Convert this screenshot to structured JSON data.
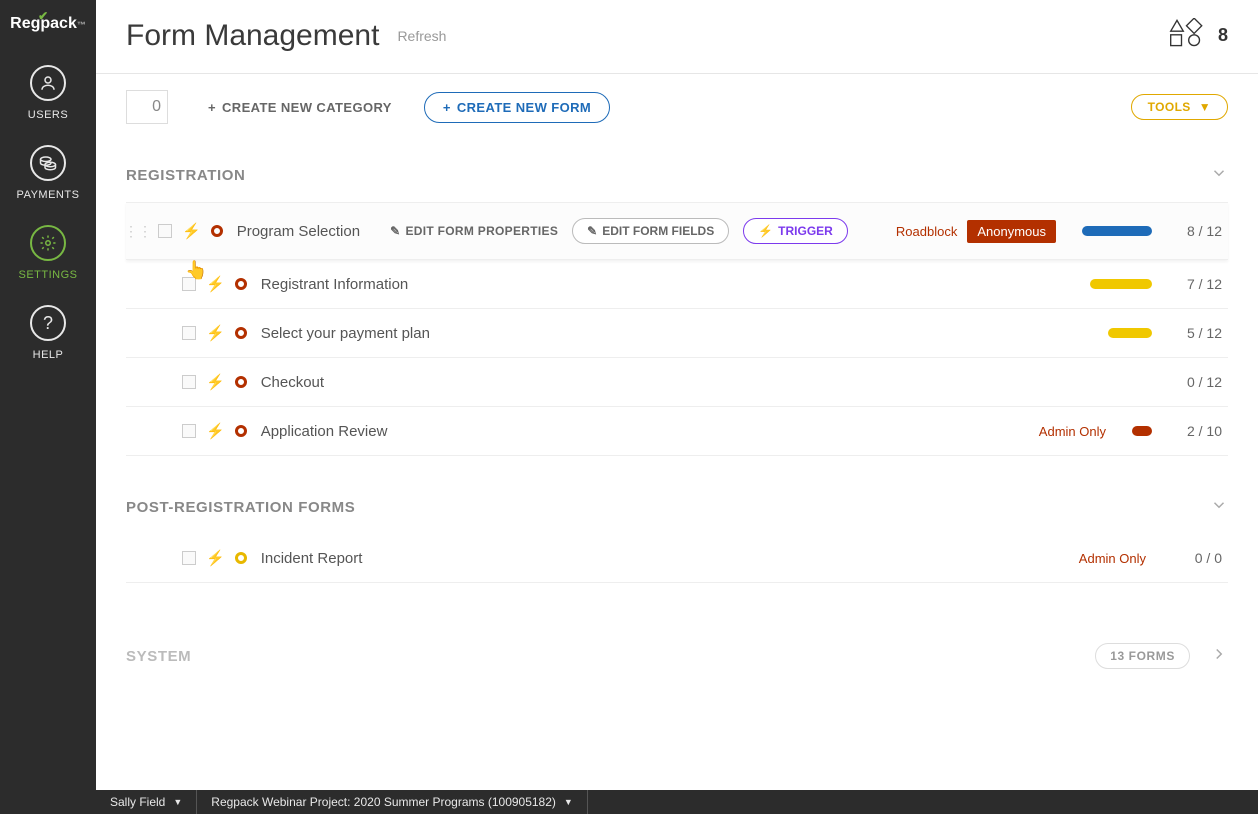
{
  "brand": "Regpack",
  "nav": {
    "users": "USERS",
    "payments": "PAYMENTS",
    "settings": "SETTINGS",
    "help": "HELP"
  },
  "header": {
    "title": "Form Management",
    "refresh": "Refresh",
    "count": "8"
  },
  "toolbar": {
    "selected_count": "0",
    "create_category": "CREATE NEW CATEGORY",
    "create_form": "CREATE NEW FORM",
    "tools": "TOOLS"
  },
  "sections": {
    "registration": "REGISTRATION",
    "post_registration": "POST-REGISTRATION FORMS",
    "system": "SYSTEM"
  },
  "actions": {
    "edit_properties": "EDIT FORM PROPERTIES",
    "edit_fields": "EDIT FORM FIELDS",
    "trigger": "TRIGGER"
  },
  "labels": {
    "roadblock": "Roadblock",
    "anonymous": "Anonymous",
    "admin_only": "Admin Only",
    "forms_count": "13 FORMS"
  },
  "forms": {
    "program_selection": {
      "name": "Program Selection",
      "ratio": "8 / 12"
    },
    "registrant_info": {
      "name": "Registrant Information",
      "ratio": "7 / 12"
    },
    "payment_plan": {
      "name": "Select your payment plan",
      "ratio": "5 / 12"
    },
    "checkout": {
      "name": "Checkout",
      "ratio": "0 / 12"
    },
    "app_review": {
      "name": "Application Review",
      "ratio": "2 / 10"
    },
    "incident": {
      "name": "Incident Report",
      "ratio": "0 / 0"
    }
  },
  "footer": {
    "user": "Sally Field",
    "project": "Regpack Webinar Project: 2020 Summer Programs (100905182)"
  }
}
